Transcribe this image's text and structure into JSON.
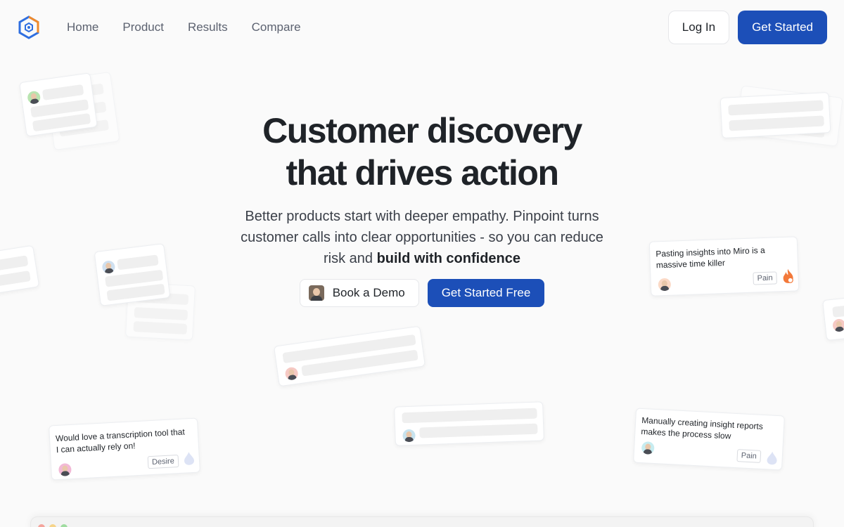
{
  "nav": {
    "links": [
      "Home",
      "Product",
      "Results",
      "Compare"
    ],
    "login_label": "Log In",
    "get_started_label": "Get Started"
  },
  "hero": {
    "title_line1": "Customer discovery",
    "title_line2": "that drives action",
    "subtitle_plain": "Better products start with deeper empathy. Pinpoint turns customer calls into clear opportunities - so you can reduce risk and ",
    "subtitle_bold": "build with confidence",
    "book_demo_label": "Book a Demo",
    "get_started_free_label": "Get Started Free"
  },
  "insight_cards": [
    {
      "quote": "Pasting insights into Miro is a massive time killer",
      "tag": "Pain",
      "icon": "flame-icon"
    },
    {
      "quote": "Would love a transcription tool that I can actually rely on!",
      "tag": "Desire",
      "icon": "drop-icon"
    },
    {
      "quote": "Manually creating insight reports makes the process slow",
      "tag": "Pain",
      "icon": "drop-icon"
    }
  ],
  "colors": {
    "primary": "#1c4fb8",
    "background": "#fafafa",
    "logo_orange": "#f08a2b",
    "logo_blue": "#2f6fe0"
  }
}
